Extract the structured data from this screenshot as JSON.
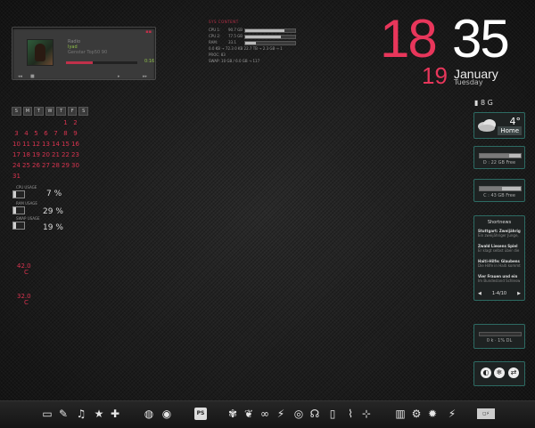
{
  "player": {
    "line1": "Radio",
    "line2": "Iyad",
    "line3": "Genstar Top50 90",
    "time": "0:16",
    "progress": 0.38,
    "controls": [
      "◂◂",
      "■",
      "▸",
      "▸▸"
    ]
  },
  "sysstats": {
    "header": "SYS CONTENT",
    "rows": [
      {
        "label": "CPU 1:",
        "value": "90.7 GB",
        "fill": 0.78
      },
      {
        "label": "CPU 2:",
        "value": "77.5 GB",
        "fill": 0.72
      },
      {
        "label": "RAM:",
        "value": "33.1",
        "fill": 0.22
      }
    ],
    "net_line": "0.0 KB → 72.3 0 KB        22.7 TB → 2.3 GB → 1",
    "proc_line": "PROC:     83",
    "swap_line": "SWAP:    10 GB / 6.0 GB → 117"
  },
  "clock": {
    "hour": "18",
    "minute": "35",
    "day": "19",
    "month": "January",
    "weekday": "Tuesday"
  },
  "calendar": {
    "headers": [
      "S",
      "M",
      "T",
      "W",
      "T",
      "F",
      "S"
    ],
    "days": [
      "",
      "",
      "",
      "",
      "",
      "1",
      "2",
      "3",
      "4",
      "5",
      "6",
      "7",
      "8",
      "9",
      "10",
      "11",
      "12",
      "13",
      "14",
      "15",
      "16",
      "17",
      "18",
      "19",
      "20",
      "21",
      "22",
      "23",
      "24",
      "25",
      "26",
      "27",
      "28",
      "29",
      "30",
      "31"
    ]
  },
  "meters": [
    {
      "label": "CPU USAGE",
      "pct": "7 %",
      "fill": 0.07
    },
    {
      "label": "RAM USAGE",
      "pct": "29 %",
      "fill": 0.29
    },
    {
      "label": "SWAP USAGE",
      "pct": "19 %",
      "fill": 0.19
    }
  ],
  "temps": [
    {
      "value": "42.0",
      "unit": "C"
    },
    {
      "value": "32.0",
      "unit": "C"
    }
  ],
  "disk_top": "8 G",
  "weather": {
    "temp": "4°",
    "location": "Home"
  },
  "drives": [
    {
      "label": "D : 22 GB Free",
      "fill": 0.72
    },
    {
      "label": "C : 43 GB Free",
      "fill": 0.55
    }
  ],
  "news": {
    "title": "Shortnews",
    "items": [
      {
        "head": "Stuttgart: Zweijährig",
        "body": "Ein zweijähriger Junge,"
      },
      {
        "head": "Zwald Liesens Spiel",
        "body": "Er klagt selbst über die"
      },
      {
        "head": "Haiti-Hilfe: Glaubens",
        "body": "Die Hilfe in Haiti kommt"
      },
      {
        "head": "Vier Frauen und ein",
        "body": "Im Bundesland Schlesw"
      }
    ],
    "prev": "◀",
    "page": "1-4/10",
    "next": "▶"
  },
  "network": {
    "text": "0 k · 1% DL"
  },
  "tools": [
    "◐",
    "❄",
    "⇄"
  ],
  "dock": {
    "icons": [
      {
        "name": "laptop-icon",
        "glyph": "▭"
      },
      {
        "name": "feather-icon",
        "glyph": "✎"
      },
      {
        "name": "music-icon",
        "glyph": "♫"
      },
      {
        "name": "star-icon",
        "glyph": "★"
      },
      {
        "name": "gamepad-icon",
        "glyph": "✚"
      },
      {
        "name": "firefox-icon",
        "glyph": "◍"
      },
      {
        "name": "thunderbird-icon",
        "glyph": "◉"
      },
      {
        "name": "photoshop-icon",
        "glyph": "PS"
      },
      {
        "name": "flower-icon",
        "glyph": "✾"
      },
      {
        "name": "leaf-icon",
        "glyph": "❦"
      },
      {
        "name": "link-icon",
        "glyph": "∞"
      },
      {
        "name": "lightning-icon",
        "glyph": "⚡"
      },
      {
        "name": "disc-icon",
        "glyph": "◎"
      },
      {
        "name": "headphones-icon",
        "glyph": "☊"
      },
      {
        "name": "ipod-icon",
        "glyph": "▯"
      },
      {
        "name": "brush-icon",
        "glyph": "⌇"
      },
      {
        "name": "selection-icon",
        "glyph": "⊹"
      },
      {
        "name": "trash-icon",
        "glyph": "▥"
      },
      {
        "name": "gear-icon",
        "glyph": "⚙"
      },
      {
        "name": "cog-icon",
        "glyph": "✹"
      },
      {
        "name": "power-icon",
        "glyph": "⚡"
      }
    ],
    "tray": "◻⚡"
  }
}
